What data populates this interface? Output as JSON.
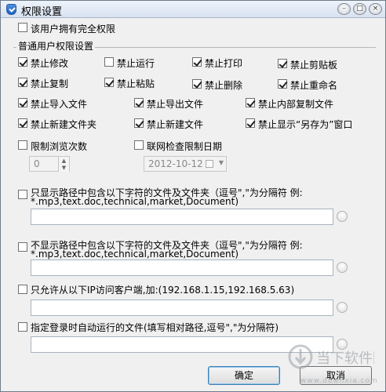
{
  "window": {
    "title": "权限设置",
    "shield_icon": "shield-check-icon"
  },
  "full_permission": {
    "label": "该用户拥有完全权限",
    "checked": false
  },
  "group_title": "普通用户权限设置",
  "permissions": [
    {
      "label": "禁止修改",
      "checked": true
    },
    {
      "label": "禁止运行",
      "checked": false
    },
    {
      "label": "禁止打印",
      "checked": true
    },
    {
      "label": "禁止剪贴板",
      "checked": true
    },
    {
      "label": "禁止复制",
      "checked": true
    },
    {
      "label": "禁止粘贴",
      "checked": true
    },
    {
      "label": "禁止删除",
      "checked": true
    },
    {
      "label": "禁止重命名",
      "checked": true
    },
    {
      "label": "禁止导入文件",
      "checked": true
    },
    {
      "label": "禁止导出文件",
      "checked": true
    },
    {
      "label": "禁止内部复制文件",
      "checked": true
    },
    {
      "label": "禁止新建文件夹",
      "checked": true
    },
    {
      "label": "禁止新建文件",
      "checked": true
    },
    {
      "label": "禁止显示“另存为”窗口",
      "checked": true
    }
  ],
  "limit_browse": {
    "label": "限制浏览次数",
    "checked": false,
    "value": "0"
  },
  "online_check": {
    "label": "联网检查限制日期",
    "checked": false,
    "date": "2012-10-12"
  },
  "path_show": {
    "label": "只显示路径中包含以下字符的文件及文件夹（逗号\",\"为分隔符 例:",
    "example": "*.mp3,text.doc,technical,market,Document)",
    "checked": false,
    "value": ""
  },
  "path_hide": {
    "label": "不显示路径中包含以下字符的文件及文件夹（逗号\",\"为分隔符 例:",
    "example": "*.mp3,text.doc,technical,market,Document)",
    "checked": false,
    "value": ""
  },
  "ip_allow": {
    "label": "只允许从以下IP访问客户端,加:(192.168.1.15,192.168.5.63)",
    "checked": false,
    "value": ""
  },
  "autorun": {
    "label": "指定登录时自动运行的文件(填写相对路径,逗号\",\"为分隔符)",
    "checked": false,
    "value": ""
  },
  "buttons": {
    "ok": "确定",
    "cancel": "取消"
  },
  "watermark": {
    "brand": "当下软件园",
    "domain": "www.downxia.com"
  }
}
